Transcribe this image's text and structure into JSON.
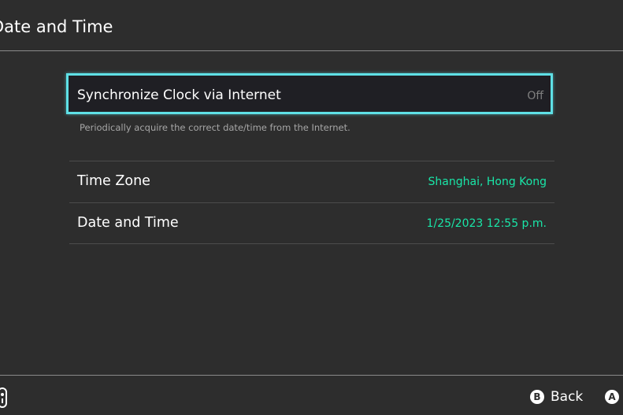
{
  "header": {
    "title": "Date and Time"
  },
  "settings": {
    "sync": {
      "label": "Synchronize Clock via Internet",
      "value": "Off",
      "description": "Periodically acquire the correct date/time from the Internet."
    },
    "time_zone": {
      "label": "Time Zone",
      "value": "Shanghai, Hong Kong"
    },
    "date_time": {
      "label": "Date and Time",
      "value": "1/25/2023 12:55 p.m."
    }
  },
  "footer": {
    "back": {
      "glyph": "B",
      "label": "Back"
    },
    "ok": {
      "glyph": "A"
    }
  },
  "colors": {
    "background": "#2d2d2d",
    "selection_border": "#5fe0e6",
    "value_accent": "#19e6a8",
    "muted_text": "#808080"
  },
  "icons": {
    "controller": "controller-icon"
  }
}
